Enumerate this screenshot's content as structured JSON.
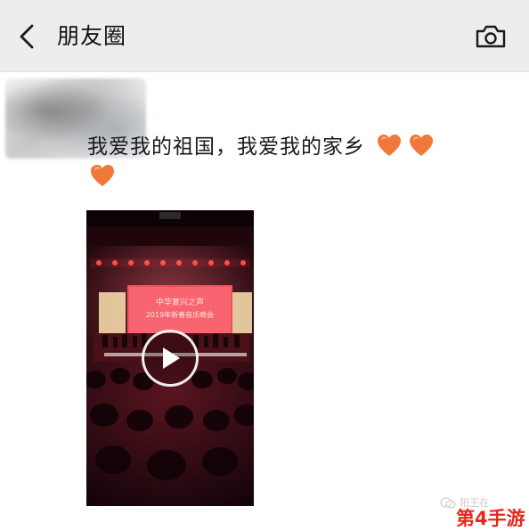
{
  "header": {
    "title": "朋友圈",
    "back_icon": "chevron-left-icon",
    "camera_icon": "camera-icon",
    "background": "#ededed"
  },
  "post": {
    "text": "我爱我的祖国，我爱我的家乡",
    "emoji": [
      "orange-heart",
      "orange-heart",
      "orange-heart"
    ],
    "heart_color": "#f07838",
    "video": {
      "stage_banner_line1": "中华复兴之声",
      "stage_banner_line2": "2019年新春音乐晚会"
    }
  },
  "watermark": {
    "small_text": "阳王在",
    "brand": "第4手游",
    "brand_color": "#e5281c"
  }
}
